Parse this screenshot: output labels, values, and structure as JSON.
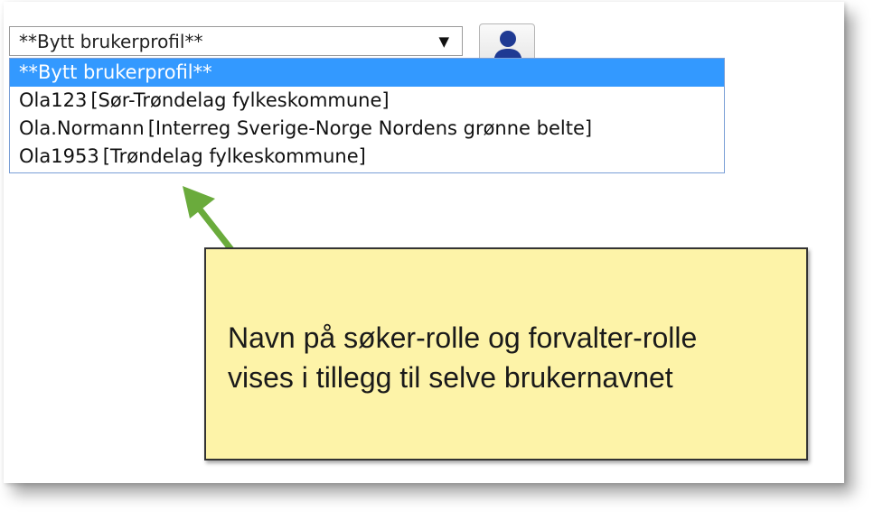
{
  "profile_select": {
    "selected_value": "**Bytt brukerprofil**",
    "caret": "▼",
    "options": [
      {
        "name": "**Bytt brukerprofil**",
        "org": "",
        "selected": true
      },
      {
        "name": "Ola123",
        "org": "[Sør-Trøndelag fylkeskommune]",
        "selected": false
      },
      {
        "name": "Ola.Normann",
        "org": "[Interreg Sverige-Norge Nordens grønne belte]",
        "selected": false
      },
      {
        "name": "Ola1953",
        "org": "[Trøndelag fylkeskommune]",
        "selected": false
      }
    ]
  },
  "user_button": {
    "icon": "user-icon",
    "color": "#1f3a93"
  },
  "annotation": {
    "line1": "Navn på søker-rolle og forvalter-rolle",
    "line2": "vises i tillegg til selve brukernavnet",
    "background": "#fdf3a8",
    "arrow_color": "#6aab3c"
  },
  "colors": {
    "highlight": "#3399ff",
    "dropdown_border": "#7a9fd6"
  }
}
